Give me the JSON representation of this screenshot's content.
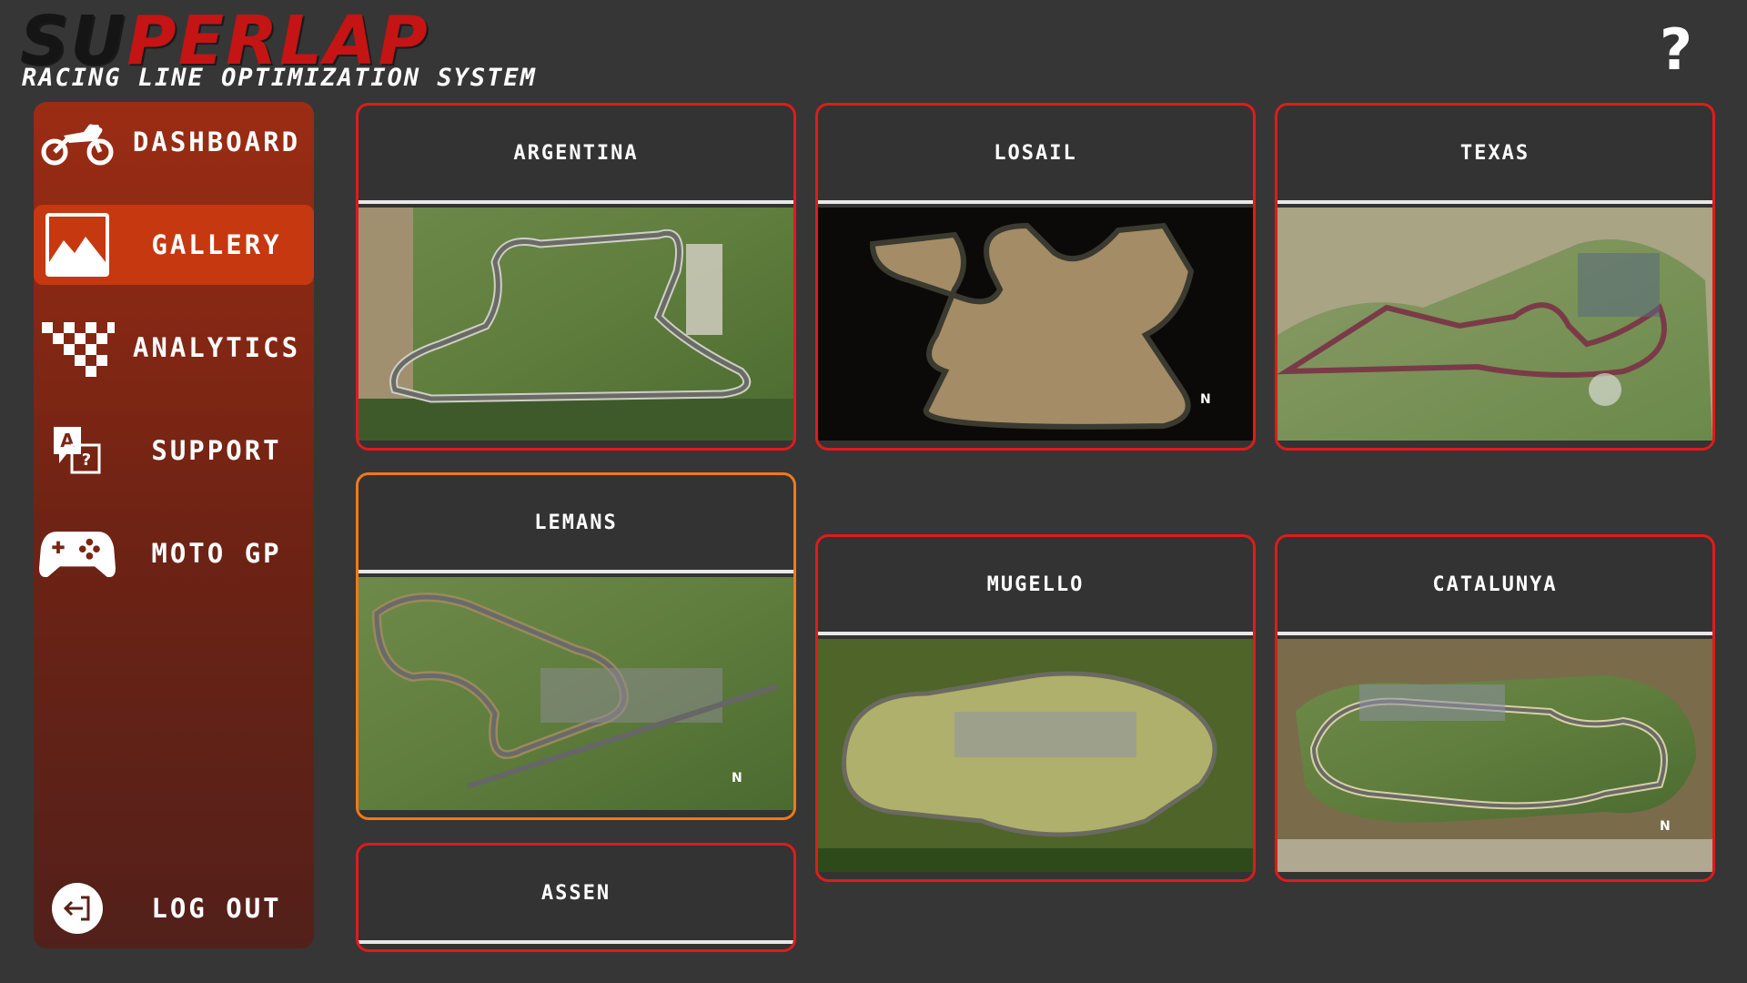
{
  "header": {
    "logo_dark": "SU",
    "logo_red": "PERLAP",
    "subtitle": "RACING LINE OPTIMIZATION SYSTEM",
    "help_label": "?"
  },
  "sidebar": {
    "items": [
      {
        "label": "DASHBOARD",
        "icon": "motorcycle-icon"
      },
      {
        "label": "GALLERY",
        "icon": "image-icon",
        "active": true
      },
      {
        "label": "ANALYTICS",
        "icon": "checkered-flag-icon"
      },
      {
        "label": "SUPPORT",
        "icon": "translate-icon"
      },
      {
        "label": "MOTO GP",
        "icon": "gamepad-icon"
      },
      {
        "label": "LOG OUT",
        "icon": "logout-icon"
      }
    ]
  },
  "gallery": {
    "tracks": [
      {
        "name": "ARGENTINA",
        "style": "day"
      },
      {
        "name": "LOSAIL",
        "style": "night"
      },
      {
        "name": "TEXAS",
        "style": "day"
      },
      {
        "name": "LEMANS",
        "style": "day",
        "selected": true
      },
      {
        "name": "MUGELLO",
        "style": "day"
      },
      {
        "name": "CATALUNYA",
        "style": "day"
      },
      {
        "name": "ASSEN",
        "style": "day"
      }
    ]
  },
  "colors": {
    "background": "#363636",
    "card_border": "#e01b1b",
    "card_selected_border": "#f07a1a",
    "sidebar_active": "#c6380f",
    "logo_red": "#c41414"
  }
}
